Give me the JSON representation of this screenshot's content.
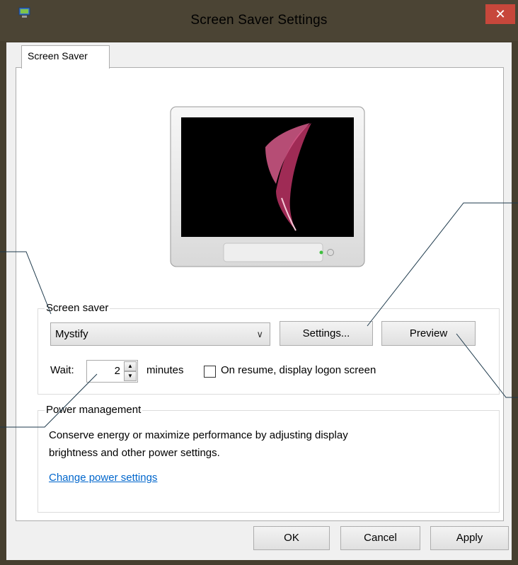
{
  "window": {
    "title": "Screen Saver Settings",
    "close_label": "✕"
  },
  "tabs": [
    {
      "label": "Screen Saver"
    }
  ],
  "screen_saver_group": {
    "label": "Screen saver",
    "selected": "Mystify",
    "settings_label": "Settings...",
    "preview_label": "Preview",
    "wait_label": "Wait:",
    "wait_value": "2",
    "minutes_label": "minutes",
    "resume_label": "On resume, display logon screen",
    "resume_checked": false
  },
  "power_group": {
    "label": "Power management",
    "description_line1": "Conserve energy or maximize performance by adjusting display",
    "description_line2": "brightness and other power settings.",
    "link_label": "Change power settings"
  },
  "buttons": {
    "ok_label": "OK",
    "cancel_label": "Cancel",
    "apply_label": "Apply"
  },
  "colors": {
    "close_button": "#c7473b",
    "link": "#0066cc",
    "title_bar": "#4b4434"
  }
}
